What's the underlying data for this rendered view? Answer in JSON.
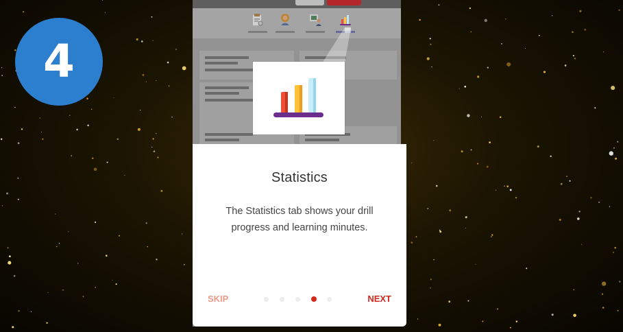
{
  "step": {
    "number": "4"
  },
  "tutorial": {
    "title": "Statistics",
    "body": "The Statistics tab shows your drill progress and learning minutes.",
    "skip_label": "SKIP",
    "next_label": "NEXT",
    "total_steps": 5,
    "current_step": 4
  },
  "app_tabs": [
    {
      "icon": "checklist-icon"
    },
    {
      "icon": "profile-icon"
    },
    {
      "icon": "presentation-icon"
    },
    {
      "icon": "statistics-icon",
      "active": true
    }
  ],
  "featured_icon": "bar-chart-icon",
  "colors": {
    "accent": "#d42a1e",
    "skip": "#e99a86",
    "badge": "#2c7fcf",
    "background": "#1b1402",
    "sparkle": "#f5c63a"
  }
}
